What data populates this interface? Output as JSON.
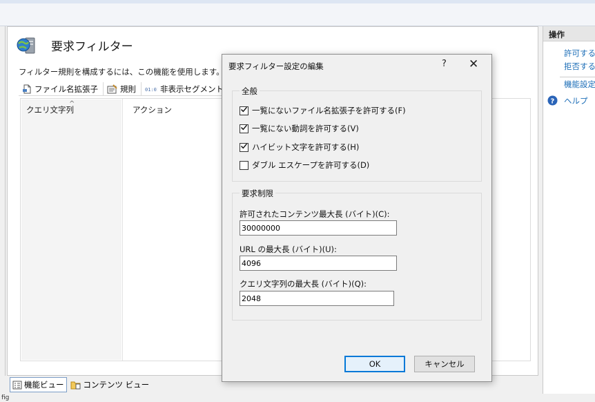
{
  "page": {
    "title": "要求フィルター",
    "description": "フィルター規則を構成するには、この機能を使用します。",
    "tabs": [
      {
        "label": "ファイル名拡張子",
        "icon": "file-extension-icon"
      },
      {
        "label": "規則",
        "icon": "rules-icon"
      },
      {
        "label": "非表示セグメント",
        "icon": "hidden-segment-icon"
      }
    ],
    "columns": {
      "query_string": "クエリ文字列",
      "action": "アクション"
    }
  },
  "bottom_tabs": [
    {
      "label": "機能ビュー",
      "icon": "features-view-icon",
      "active": true
    },
    {
      "label": "コンテンツ ビュー",
      "icon": "content-view-icon",
      "active": false
    }
  ],
  "status_text": "fig",
  "actions_panel": {
    "header": "操作",
    "links": [
      "許可する",
      "拒否する",
      "機能設定"
    ],
    "help": "ヘルプ"
  },
  "dialog": {
    "title": "要求フィルター設定の編集",
    "help_glyph": "?",
    "close_glyph": "✕",
    "general": {
      "label": "全般",
      "options": [
        {
          "label": "一覧にないファイル名拡張子を許可する(F)",
          "checked": true
        },
        {
          "label": "一覧にない動詞を許可する(V)",
          "checked": true
        },
        {
          "label": "ハイビット文字を許可する(H)",
          "checked": true
        },
        {
          "label": "ダブル エスケープを許可する(D)",
          "checked": false
        }
      ]
    },
    "limits": {
      "label": "要求制限",
      "max_content_length_label": "許可されたコンテンツ最大長 (バイト)(C):",
      "max_content_length": "30000000",
      "max_url_label": "URL の最大長 (バイト)(U):",
      "max_url": "4096",
      "max_query_label": "クエリ文字列の最大長 (バイト)(Q):",
      "max_query": "2048"
    },
    "ok_label": "OK",
    "cancel_label": "キャンセル"
  },
  "colors": {
    "link": "#1e6fb8",
    "accent_border": "#0078d7"
  }
}
